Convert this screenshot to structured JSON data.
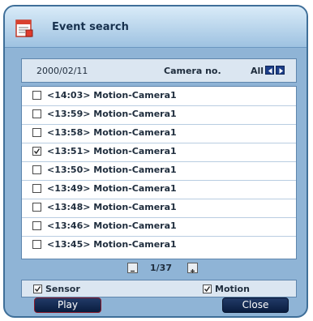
{
  "window": {
    "title": "Event search",
    "icon": "calendar-icon"
  },
  "header": {
    "date": "2000/02/11",
    "camera_label": "Camera no.",
    "camera_value": "All"
  },
  "events": [
    {
      "label": "<14:03> Motion-Camera1",
      "checked": false
    },
    {
      "label": "<13:59> Motion-Camera1",
      "checked": false
    },
    {
      "label": "<13:58> Motion-Camera1",
      "checked": false
    },
    {
      "label": "<13:51> Motion-Camera1",
      "checked": true
    },
    {
      "label": "<13:50> Motion-Camera1",
      "checked": false
    },
    {
      "label": "<13:49> Motion-Camera1",
      "checked": false
    },
    {
      "label": "<13:48> Motion-Camera1",
      "checked": false
    },
    {
      "label": "<13:46> Motion-Camera1",
      "checked": false
    },
    {
      "label": "<13:45> Motion-Camera1",
      "checked": false
    }
  ],
  "pager": {
    "text": "1/37"
  },
  "filters": {
    "sensor": {
      "label": "Sensor",
      "checked": true
    },
    "motion": {
      "label": "Motion",
      "checked": true
    }
  },
  "buttons": {
    "play": "Play",
    "close": "Close"
  },
  "colors": {
    "frame": "#8fb4d6",
    "button": "#0a1d3f",
    "accent": "#1d3f8a"
  }
}
